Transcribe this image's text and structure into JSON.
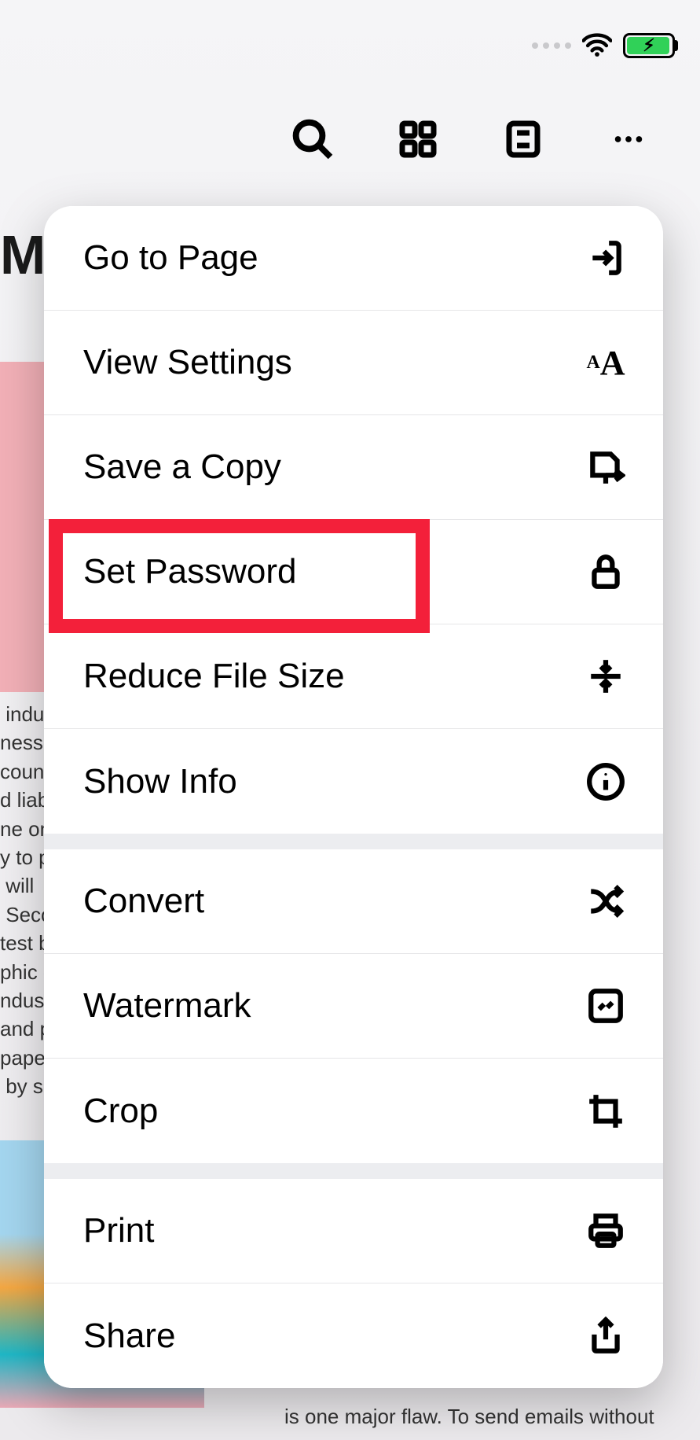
{
  "status": {
    "wifi": true,
    "battery_charging": true
  },
  "background": {
    "title_fragment": "M",
    "text_fragment": " indus\nnesses\ncount\nd liab\nne one\ny to p\n will \n Seco\ntest b\nphic o\nndustr\nand pa\npaperw\n by s",
    "below_text": "is one major flaw. To send emails without"
  },
  "menu": {
    "group1": {
      "go_to_page": "Go to Page",
      "view_settings": "View Settings",
      "save_copy": "Save a Copy",
      "set_password": "Set Password",
      "reduce_size": "Reduce File Size",
      "show_info": "Show Info"
    },
    "group2": {
      "convert": "Convert",
      "watermark": "Watermark",
      "crop": "Crop"
    },
    "group3": {
      "print": "Print",
      "share": "Share"
    }
  },
  "highlight": {
    "target": "set_password"
  }
}
